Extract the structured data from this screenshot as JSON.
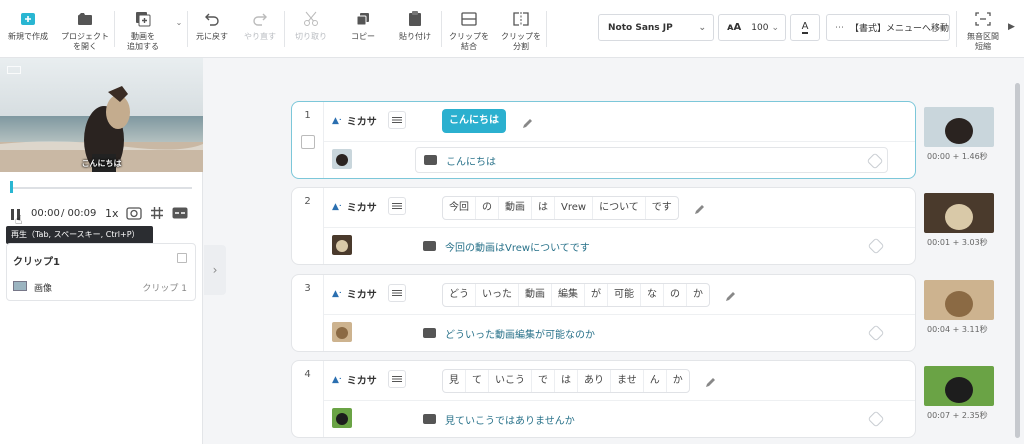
{
  "toolbar": {
    "new_project": [
      "新規で作成",
      ""
    ],
    "open_project": [
      "プロジェクト",
      "を開く"
    ],
    "add_video": [
      "動画を",
      "追加する"
    ],
    "undo": "元に戻す",
    "redo": "やり直す",
    "cut": "切り取り",
    "copy": "コピー",
    "paste": "貼り付け",
    "merge_clip": [
      "クリップを",
      "結合"
    ],
    "split_clip": [
      "クリップを",
      "分割"
    ],
    "font_name": "Noto Sans JP",
    "font_size": "100",
    "format_menu": "【書式】メニューへ移動",
    "silence_label": [
      "無音区間",
      "短縮"
    ]
  },
  "preview": {
    "caption": "こんにちは",
    "time_current": "00:00",
    "time_total": "/ 00:09",
    "speed": "1x",
    "tooltip": "再生（Tab, スペースキー, Ctrl+P）"
  },
  "clip_panel": {
    "title": "クリップ1",
    "item_label": "画像",
    "item_value": "クリップ 1"
  },
  "clips": [
    {
      "number": "1",
      "speaker": "ミカサ",
      "words": [
        "こんにちは"
      ],
      "subtitle": "こんにちは",
      "timecode": "00:00 + 1.46秒",
      "selected": true
    },
    {
      "number": "2",
      "speaker": "ミカサ",
      "words": [
        "今回",
        "の",
        "動画",
        "は",
        "Vrew",
        "について",
        "です"
      ],
      "subtitle": "今回の動画はVrewについてです",
      "timecode": "00:01 + 3.03秒",
      "selected": false
    },
    {
      "number": "3",
      "speaker": "ミカサ",
      "words": [
        "どう",
        "いった",
        "動画",
        "編集",
        "が",
        "可能",
        "な",
        "の",
        "か"
      ],
      "subtitle": "どういった動画編集が可能なのか",
      "timecode": "00:04 + 3.11秒",
      "selected": false
    },
    {
      "number": "4",
      "speaker": "ミカサ",
      "words": [
        "見",
        "て",
        "いこう",
        "で",
        "は",
        "あり",
        "ませ",
        "ん",
        "か"
      ],
      "subtitle": "見ていこうではありませんか",
      "timecode": "00:07 + 2.35秒",
      "selected": false
    }
  ],
  "colors": {
    "accent": "#2bb0cf",
    "subtitle_text": "#29728a",
    "tooltip_bg": "#2b2d31"
  }
}
